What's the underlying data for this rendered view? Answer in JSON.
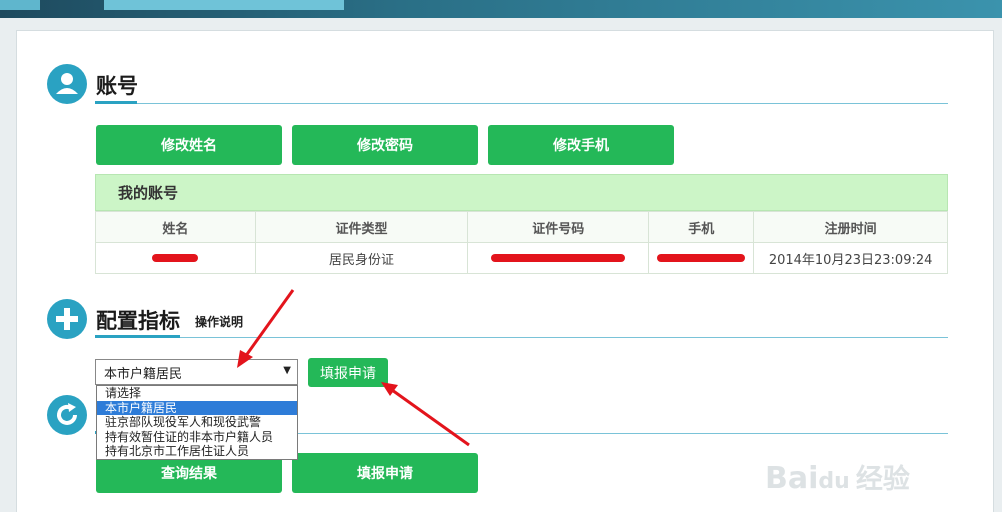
{
  "account": {
    "section_title": "账号",
    "buttons": {
      "edit_name": "修改姓名",
      "edit_password": "修改密码",
      "edit_phone": "修改手机"
    },
    "panel_title": "我的账号",
    "columns": [
      "姓名",
      "证件类型",
      "证件号码",
      "手机",
      "注册时间"
    ],
    "row": {
      "name": "",
      "id_type": "居民身份证",
      "id_number": "",
      "phone": "",
      "reg_time": "2014年10月23日23:09:24"
    }
  },
  "config": {
    "section_title": "配置指标",
    "help_link": "操作说明",
    "select_value": "本市户籍居民",
    "options": [
      "请选择",
      "本市户籍居民",
      "驻京部队现役军人和现役武警",
      "持有效暂住证的非本市户籍人员",
      "持有北京市工作居住证人员"
    ],
    "selected_index": 1,
    "apply_button": "填报申请"
  },
  "results": {
    "query_button": "查询结果",
    "apply_button": "填报申请"
  },
  "icons": {
    "account": "user-icon",
    "config": "plus-icon",
    "results": "refresh-icon",
    "dropdown": "caret-down-icon"
  },
  "watermark": {
    "latin": "Bai",
    "du": "du",
    "cn": "经验"
  },
  "colors": {
    "accent": "#2aa2c2",
    "button": "#24b858",
    "header_bg": "#ccf5c7",
    "annotation": "#e3141c"
  }
}
